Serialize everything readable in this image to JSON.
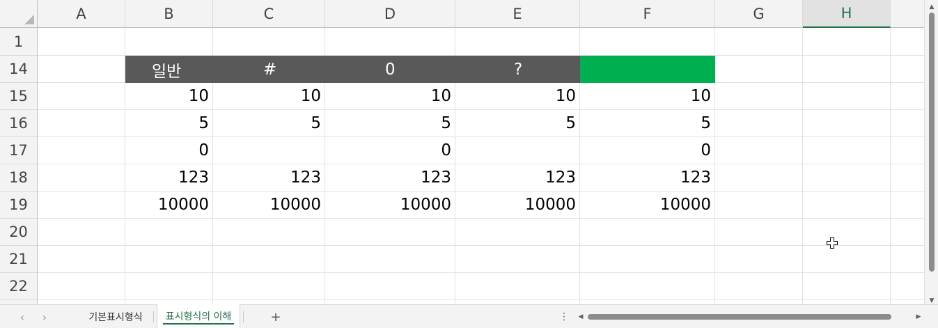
{
  "columns": [
    "A",
    "B",
    "C",
    "D",
    "E",
    "F",
    "G",
    "H"
  ],
  "selected_column": "H",
  "rows": [
    "1",
    "14",
    "15",
    "16",
    "17",
    "18",
    "19",
    "20",
    "21",
    "22"
  ],
  "table": {
    "headers": [
      "일반",
      "#",
      "0",
      "?",
      ""
    ],
    "header_bg": "#595959",
    "header_fg": "#ffffff",
    "highlight_bg": "#00b050",
    "data": {
      "15": [
        "10",
        "10",
        "10",
        "10",
        "10"
      ],
      "16": [
        "5",
        "5",
        "5",
        "5",
        "5"
      ],
      "17": [
        "0",
        "",
        "0",
        "",
        "0"
      ],
      "18": [
        "123",
        "123",
        "123",
        "123",
        "123"
      ],
      "19": [
        "10000",
        "10000",
        "10000",
        "10000",
        "10000"
      ]
    }
  },
  "sheet_tabs": [
    {
      "label": "기본표시형식",
      "active": false
    },
    {
      "label": "표시형식의 이해",
      "active": true
    }
  ],
  "icons": {
    "nav_prev": "‹",
    "nav_next": "›",
    "add_sheet": "+",
    "more_options": "⋮",
    "scroll_up": "▲",
    "scroll_down": "▼",
    "scroll_left": "◀",
    "scroll_right": "▶"
  },
  "accent_color": "#217346"
}
